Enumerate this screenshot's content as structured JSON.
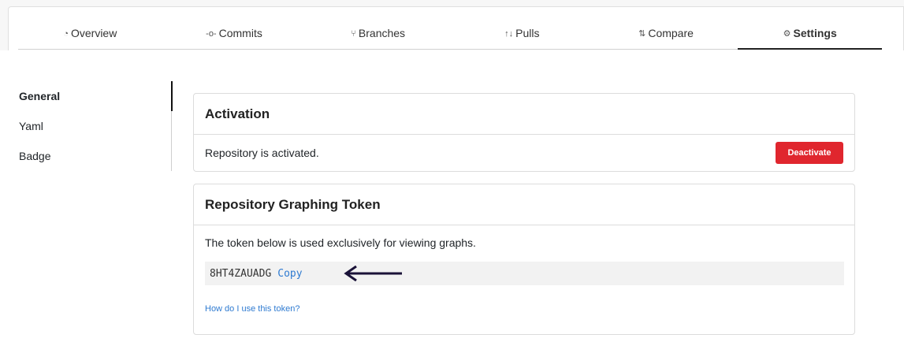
{
  "tabs": [
    {
      "label": "Overview",
      "icon": "dashboard-icon",
      "glyph": "◔"
    },
    {
      "label": "Commits",
      "icon": "commit-icon",
      "glyph": "-o-"
    },
    {
      "label": "Branches",
      "icon": "branch-icon",
      "glyph": "⑂"
    },
    {
      "label": "Pulls",
      "icon": "pull-request-icon",
      "glyph": "↑↓"
    },
    {
      "label": "Compare",
      "icon": "compare-icon",
      "glyph": "⇅"
    },
    {
      "label": "Settings",
      "icon": "gears-icon",
      "glyph": "⚙"
    }
  ],
  "active_tab": "Settings",
  "sidebar": {
    "items": [
      {
        "label": "General"
      },
      {
        "label": "Yaml"
      },
      {
        "label": "Badge"
      }
    ],
    "active": "General"
  },
  "activation": {
    "title": "Activation",
    "status_text": "Repository is activated.",
    "button_label": "Deactivate"
  },
  "graphing_token": {
    "title": "Repository Graphing Token",
    "description": "The token below is used exclusively for viewing graphs.",
    "token": "8HT4ZAUADG",
    "copy_label": "Copy",
    "help_link": "How do I use this token?"
  },
  "colors": {
    "danger": "#e0262e",
    "link": "#2f7bd1",
    "arrow": "#1a1238"
  }
}
